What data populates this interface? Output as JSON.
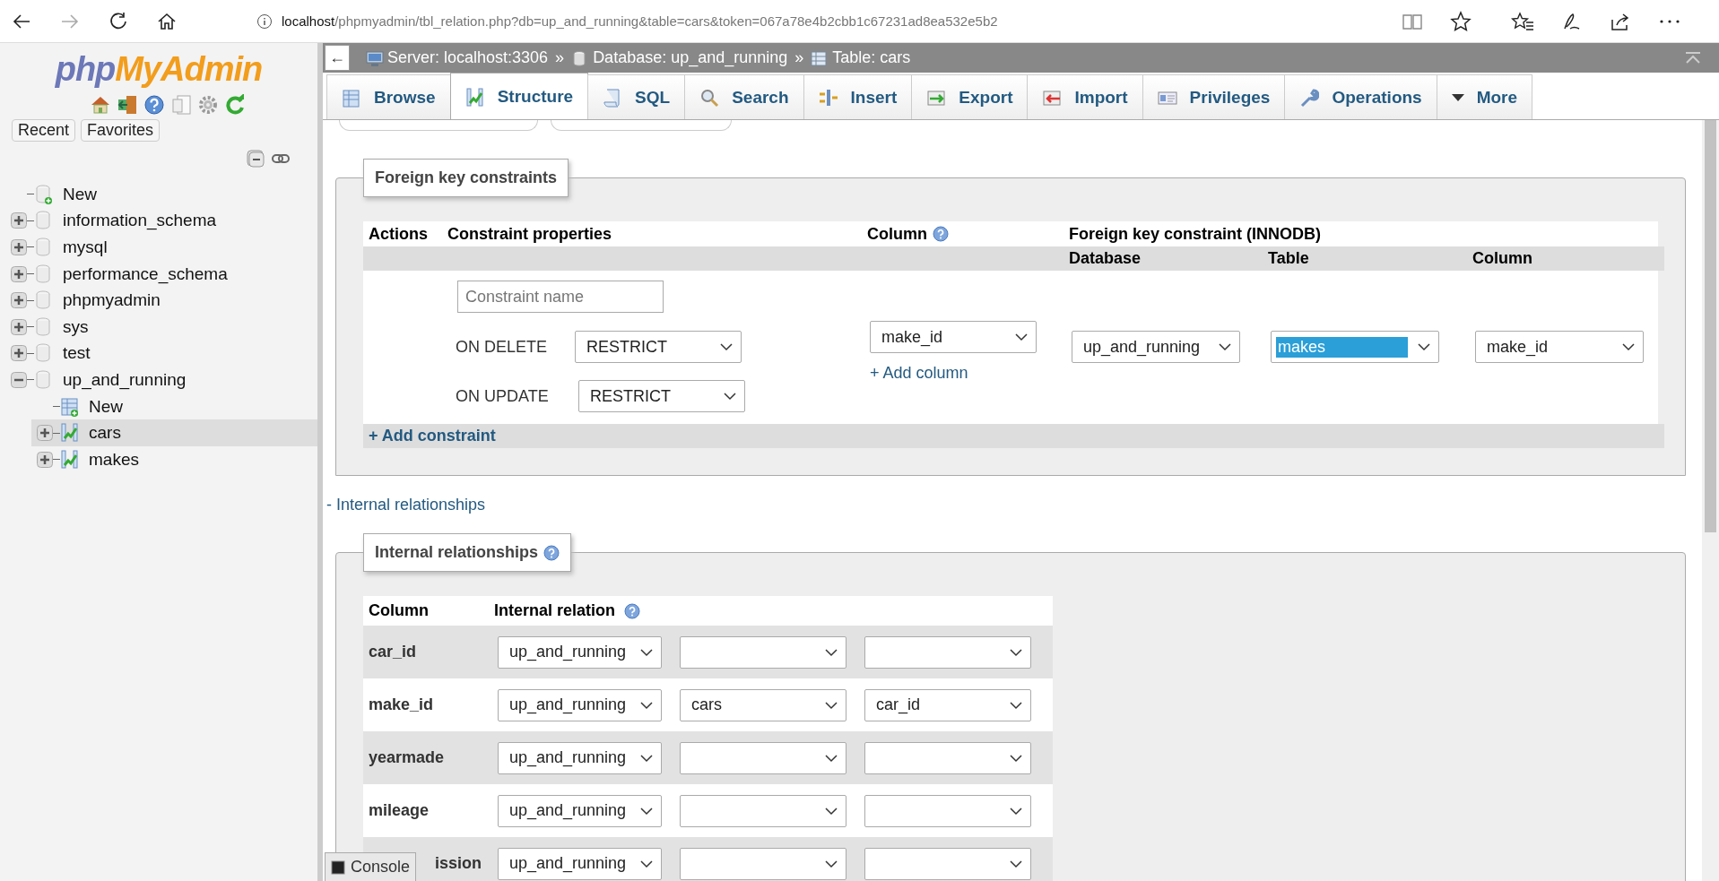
{
  "browser": {
    "address": {
      "host": "localhost",
      "path": "/phpmyadmin/tbl_relation.php?db=up_and_running&table=cars&token=067a78e4b2cbb1c67231ad8ea532e5b2"
    }
  },
  "sidebar": {
    "logo": {
      "part_1": "php",
      "part_2": "MyAdmin"
    },
    "buttons": [
      "Recent",
      "Favorites"
    ],
    "tree": [
      {
        "label": "New",
        "kind": "new"
      },
      {
        "label": "information_schema",
        "kind": "db",
        "expanded": false
      },
      {
        "label": "mysql",
        "kind": "db",
        "expanded": false
      },
      {
        "label": "performance_schema",
        "kind": "db",
        "expanded": false
      },
      {
        "label": "phpmyadmin",
        "kind": "db",
        "expanded": false
      },
      {
        "label": "sys",
        "kind": "db",
        "expanded": false
      },
      {
        "label": "test",
        "kind": "db",
        "expanded": false
      },
      {
        "label": "up_and_running",
        "kind": "db",
        "expanded": true,
        "children": [
          {
            "label": "New",
            "kind": "newtable"
          },
          {
            "label": "cars",
            "kind": "table",
            "expanded": false,
            "selected": true
          },
          {
            "label": "makes",
            "kind": "table",
            "expanded": false,
            "selected": false
          }
        ]
      }
    ]
  },
  "topbar": {
    "back": "←",
    "crumbs": [
      {
        "label": "Server: localhost:3306",
        "kind": "server",
        "separator": "»"
      },
      {
        "label": "Database: up_and_running",
        "kind": "database",
        "separator": "»"
      },
      {
        "label": "Table: cars",
        "kind": "table"
      }
    ]
  },
  "tabs": [
    {
      "label": "Browse",
      "kind": "browse",
      "selected": false
    },
    {
      "label": "Structure",
      "kind": "structure",
      "selected": true
    },
    {
      "label": "SQL",
      "kind": "sql",
      "selected": false
    },
    {
      "label": "Search",
      "kind": "search",
      "selected": false
    },
    {
      "label": "Insert",
      "kind": "insert",
      "selected": false
    },
    {
      "label": "Export",
      "kind": "export",
      "selected": false
    },
    {
      "label": "Import",
      "kind": "import",
      "selected": false
    },
    {
      "label": "Privileges",
      "kind": "privileges",
      "selected": false
    },
    {
      "label": "Operations",
      "kind": "operations",
      "selected": false
    },
    {
      "label": "More",
      "kind": "more",
      "selected": false
    }
  ],
  "foreign_keys": {
    "legend": "Foreign key constraints",
    "headers": {
      "actions": "Actions",
      "properties": "Constraint properties",
      "column": "Column",
      "group": "Foreign key constraint (INNODB)",
      "database": "Database",
      "table": "Table",
      "ref_column": "Column"
    },
    "constraint_name": {
      "placeholder": "Constraint name"
    },
    "on_delete": {
      "label": "ON DELETE",
      "value": "RESTRICT"
    },
    "on_update": {
      "label": "ON UPDATE",
      "value": "RESTRICT"
    },
    "column": "make_id",
    "add_column": "+ Add column",
    "database": {
      "value": "up_and_running",
      "focused": false
    },
    "table": {
      "value": "makes",
      "focused": true
    },
    "ref_column": {
      "value": "make_id",
      "focused": false
    },
    "add_constraint": "+ Add constraint"
  },
  "internal_toggle": "- Internal relationships",
  "internal": {
    "legend": "Internal relationships",
    "headers": {
      "column": "Column",
      "relation": "Internal relation"
    },
    "rows": [
      {
        "column": "car_id",
        "database": "up_and_running"
      },
      {
        "column": "make_id",
        "database": "up_and_running",
        "table": "cars",
        "ref_column": "car_id"
      },
      {
        "column": "yearmade",
        "database": "up_and_running"
      },
      {
        "column": "mileage",
        "database": "up_and_running"
      },
      {
        "column": "ission",
        "database": "up_and_running"
      }
    ]
  },
  "console": "Console"
}
